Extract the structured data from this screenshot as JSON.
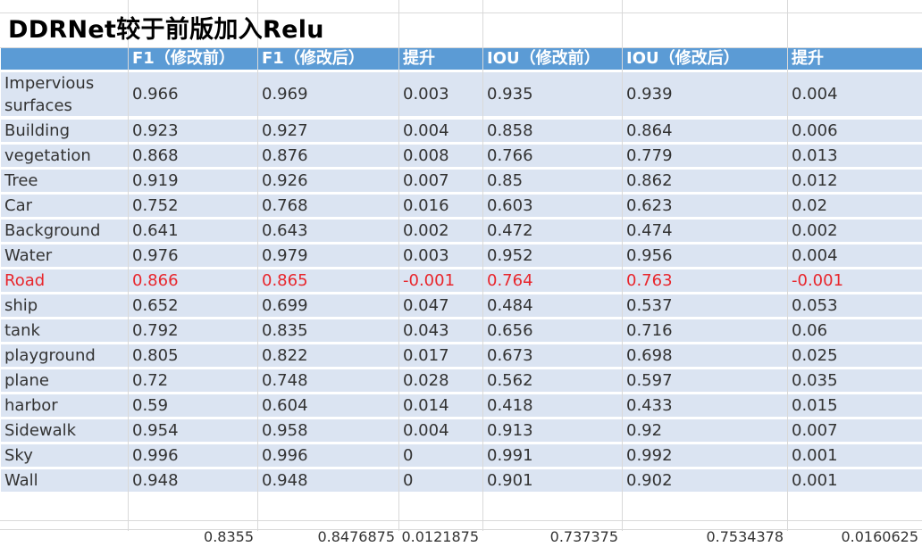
{
  "title": "DDRNet较于前版加入Relu",
  "headers": [
    "",
    "F1（修改前）",
    "F1（修改后）",
    "提升",
    "IOU（修改前）",
    "IOU（修改后）",
    "提升"
  ],
  "rows": [
    [
      "Impervious surfaces",
      "0.966",
      "0.969",
      "0.003",
      "0.935",
      "0.939",
      "0.004"
    ],
    [
      "Building",
      "0.923",
      "0.927",
      "0.004",
      "0.858",
      "0.864",
      "0.006"
    ],
    [
      "vegetation",
      "0.868",
      "0.876",
      "0.008",
      "0.766",
      "0.779",
      "0.013"
    ],
    [
      "Tree",
      "0.919",
      "0.926",
      "0.007",
      "0.85",
      "0.862",
      "0.012"
    ],
    [
      "Car",
      "0.752",
      "0.768",
      "0.016",
      "0.603",
      "0.623",
      "0.02"
    ],
    [
      "Background",
      "0.641",
      "0.643",
      "0.002",
      "0.472",
      "0.474",
      "0.002"
    ],
    [
      "Water",
      "0.976",
      "0.979",
      "0.003",
      "0.952",
      "0.956",
      "0.004"
    ],
    [
      "Road",
      "0.866",
      "0.865",
      "-0.001",
      "0.764",
      "0.763",
      "-0.001"
    ],
    [
      "ship",
      "0.652",
      "0.699",
      "0.047",
      "0.484",
      "0.537",
      "0.053"
    ],
    [
      "tank",
      "0.792",
      "0.835",
      "0.043",
      "0.656",
      "0.716",
      "0.06"
    ],
    [
      "playground",
      "0.805",
      "0.822",
      "0.017",
      "0.673",
      "0.698",
      "0.025"
    ],
    [
      "plane",
      "0.72",
      "0.748",
      "0.028",
      "0.562",
      "0.597",
      "0.035"
    ],
    [
      "harbor",
      "0.59",
      "0.604",
      "0.014",
      "0.418",
      "0.433",
      "0.015"
    ],
    [
      "Sidewalk",
      "0.954",
      "0.958",
      "0.004",
      "0.913",
      "0.92",
      "0.007"
    ],
    [
      "Sky",
      "0.996",
      "0.996",
      "0",
      "0.991",
      "0.992",
      "0.001"
    ],
    [
      "Wall",
      "0.948",
      "0.948",
      "0",
      "0.901",
      "0.902",
      "0.001"
    ]
  ],
  "highlight_row_label": "Road",
  "averages": [
    "",
    "0.8355",
    "0.8476875",
    "0.0121875",
    "0.737375",
    "0.7534378",
    "0.0160625"
  ],
  "colors": {
    "header_fill": "#5b9bd5",
    "row_fill": "#dbe4f2",
    "text": "#333333",
    "highlight_text": "#e8262c",
    "header_text": "#ffffff",
    "gridline": "#d9d9d9"
  }
}
